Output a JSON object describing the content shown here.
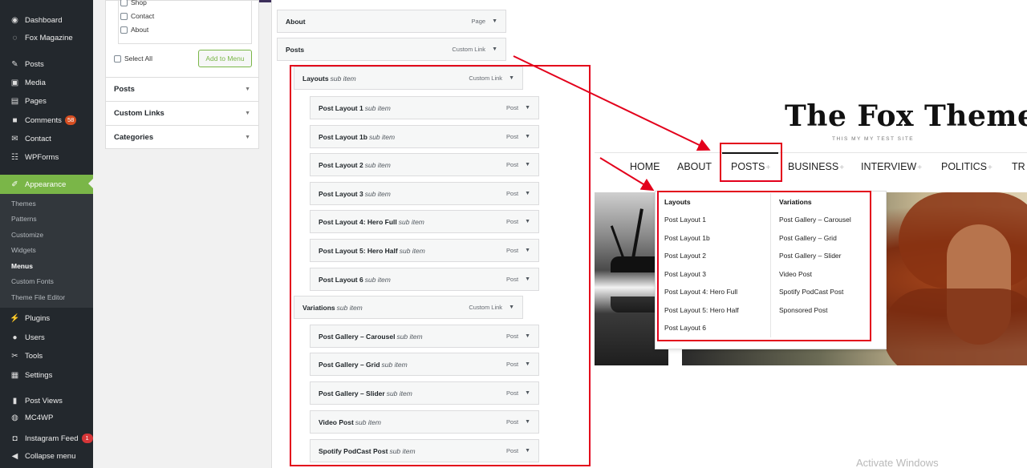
{
  "wp_sidebar": {
    "items_top": [
      {
        "label": "Dashboard",
        "icon": "dashboard-icon"
      },
      {
        "label": "Fox Magazine",
        "icon": "fox-icon"
      }
    ],
    "items_mid": [
      {
        "label": "Posts",
        "icon": "pin-icon"
      },
      {
        "label": "Media",
        "icon": "media-icon"
      },
      {
        "label": "Pages",
        "icon": "pages-icon"
      },
      {
        "label": "Comments",
        "icon": "comment-icon",
        "badge": "58"
      },
      {
        "label": "Contact",
        "icon": "mail-icon"
      },
      {
        "label": "WPForms",
        "icon": "forms-icon"
      }
    ],
    "appearance": {
      "label": "Appearance",
      "icon": "brush-icon"
    },
    "appearance_sub": [
      "Themes",
      "Patterns",
      "Customize",
      "Widgets",
      "Menus",
      "Custom Fonts",
      "Theme File Editor"
    ],
    "current_sub": "Menus",
    "items_bottom": [
      {
        "label": "Plugins",
        "icon": "plug-icon"
      },
      {
        "label": "Users",
        "icon": "user-icon"
      },
      {
        "label": "Tools",
        "icon": "wrench-icon"
      },
      {
        "label": "Settings",
        "icon": "settings-icon"
      }
    ],
    "items_extra": [
      {
        "label": "Post Views",
        "icon": "bars-icon"
      },
      {
        "label": "MC4WP",
        "icon": "mc4wp-icon"
      },
      {
        "label": "Instagram Feed",
        "icon": "instagram-icon",
        "badge": "1"
      },
      {
        "label": "Collapse menu",
        "icon": "collapse-icon"
      }
    ]
  },
  "add_items_panel": {
    "pages_checkboxes": [
      "Shop",
      "Contact",
      "About"
    ],
    "select_all": "Select All",
    "add_button": "Add to Menu",
    "sections": [
      "Posts",
      "Custom Links",
      "Categories"
    ]
  },
  "menu_structure": {
    "sub_item_label": "sub item",
    "items": [
      {
        "title": "About",
        "sub": false,
        "type": "Page"
      },
      {
        "title": "Posts",
        "sub": false,
        "type": "Custom Link"
      },
      {
        "title": "Layouts",
        "sub": true,
        "type": "Custom Link"
      },
      {
        "title": "Post Layout 1",
        "sub": true,
        "type": "Post"
      },
      {
        "title": "Post Layout 1b",
        "sub": true,
        "type": "Post"
      },
      {
        "title": "Post Layout 2",
        "sub": true,
        "type": "Post"
      },
      {
        "title": "Post Layout 3",
        "sub": true,
        "type": "Post"
      },
      {
        "title": "Post Layout 4: Hero Full",
        "sub": true,
        "type": "Post"
      },
      {
        "title": "Post Layout 5: Hero Half",
        "sub": true,
        "type": "Post"
      },
      {
        "title": "Post Layout 6",
        "sub": true,
        "type": "Post"
      },
      {
        "title": "Variations",
        "sub": true,
        "type": "Custom Link"
      },
      {
        "title": "Post Gallery – Carousel",
        "sub": true,
        "type": "Post"
      },
      {
        "title": "Post Gallery – Grid",
        "sub": true,
        "type": "Post"
      },
      {
        "title": "Post Gallery – Slider",
        "sub": true,
        "type": "Post"
      },
      {
        "title": "Video Post",
        "sub": true,
        "type": "Post"
      },
      {
        "title": "Spotify PodCast Post",
        "sub": true,
        "type": "Post"
      }
    ]
  },
  "fox_site": {
    "title": "The Fox Theme",
    "tagline": "THIS MY MY TEST SITE",
    "nav": [
      "HOME",
      "ABOUT",
      "POSTS",
      "BUSINESS",
      "INTERVIEW",
      "POLITICS",
      "TR"
    ],
    "dropdown": {
      "col1_head": "Layouts",
      "col1": [
        "Post Layout 1",
        "Post Layout 1b",
        "Post Layout 2",
        "Post Layout 3",
        "Post Layout 4: Hero Full",
        "Post Layout 5: Hero Half",
        "Post Layout 6"
      ],
      "col2_head": "Variations",
      "col2": [
        "Post Gallery – Carousel",
        "Post Gallery – Grid",
        "Post Gallery – Slider",
        "Video Post",
        "Spotify PodCast Post",
        "Sponsored Post"
      ]
    }
  },
  "watermark": "Activate Windows",
  "colors": {
    "wp_dark": "#23282d",
    "wp_green": "#7ab648",
    "annotation_red": "#e3001b"
  }
}
